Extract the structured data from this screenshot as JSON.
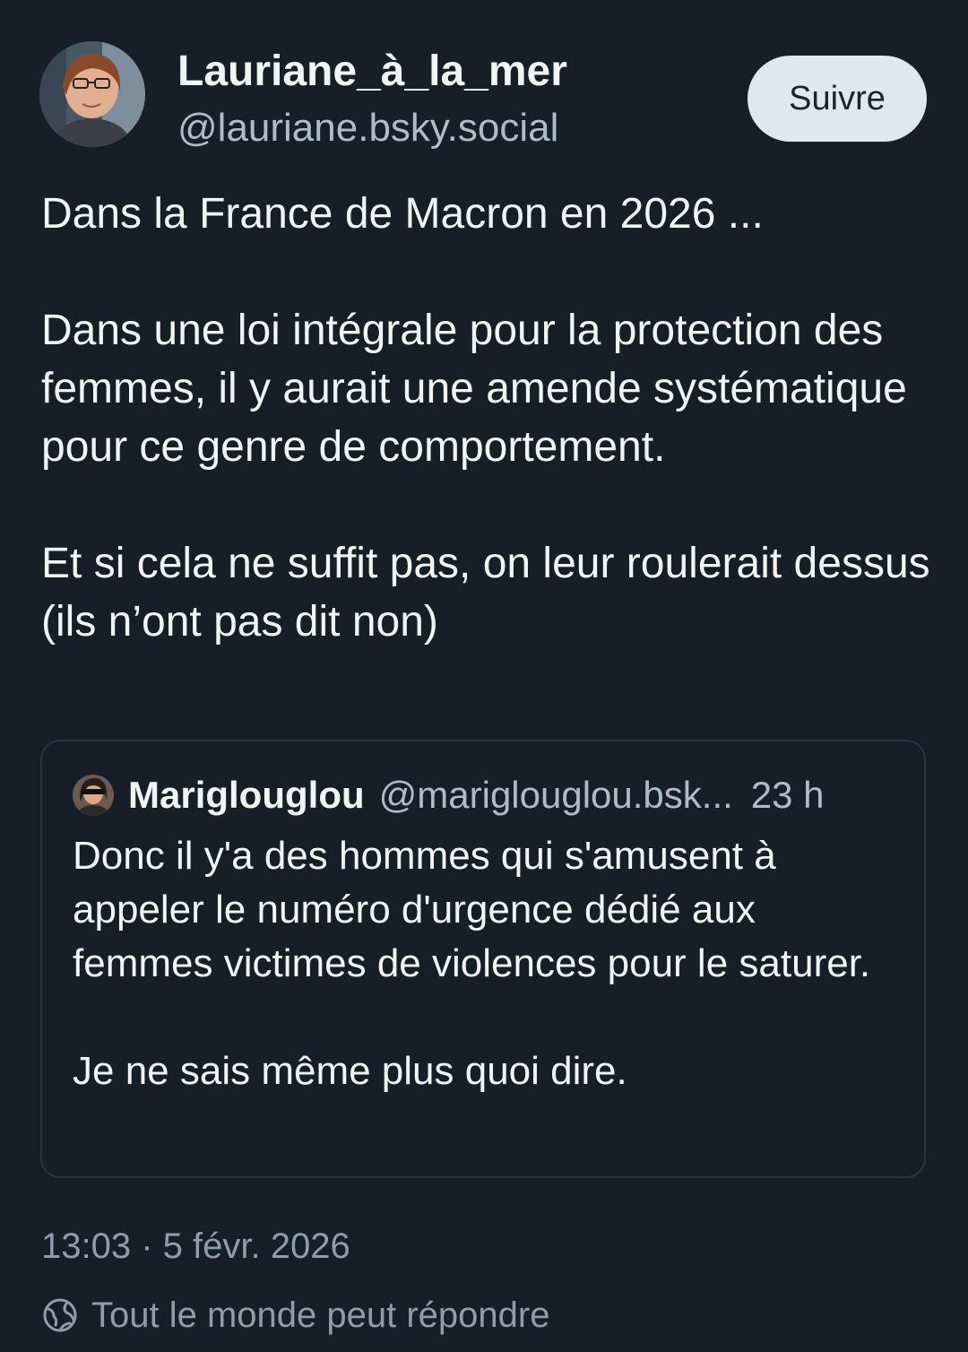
{
  "author": {
    "display_name": "Lauriane_à_la_mer",
    "handle": "@lauriane.bsky.social"
  },
  "follow_button": {
    "label": "Suivre"
  },
  "post": {
    "paragraphs": [
      "Dans la France de Macron en 2026 ...",
      "Dans une loi intégrale pour la protection des femmes, il y aurait une amende systématique pour ce genre de comportement.",
      "Et si cela ne suffit pas, on leur roulerait dessus (ils n’ont pas dit non)"
    ]
  },
  "quoted_post": {
    "display_name": "Mariglouglou",
    "handle": "@mariglouglou.bsk...",
    "time": "23 h",
    "paragraphs": [
      "Donc il y'a des hommes qui s'amusent à appeler le numéro d'urgence dédié aux femmes victimes de violences pour le saturer.",
      "Je ne sais même plus quoi dire."
    ]
  },
  "timestamp": "13:03 · 5 févr. 2026",
  "reply_setting": {
    "label": "Tout le monde peut répondre",
    "icon": "globe-icon"
  },
  "colors": {
    "background": "#161e27",
    "text": "#f1f3f5",
    "muted": "#aebbc9",
    "button_bg": "#e2e7ee",
    "border": "#2a3542"
  }
}
